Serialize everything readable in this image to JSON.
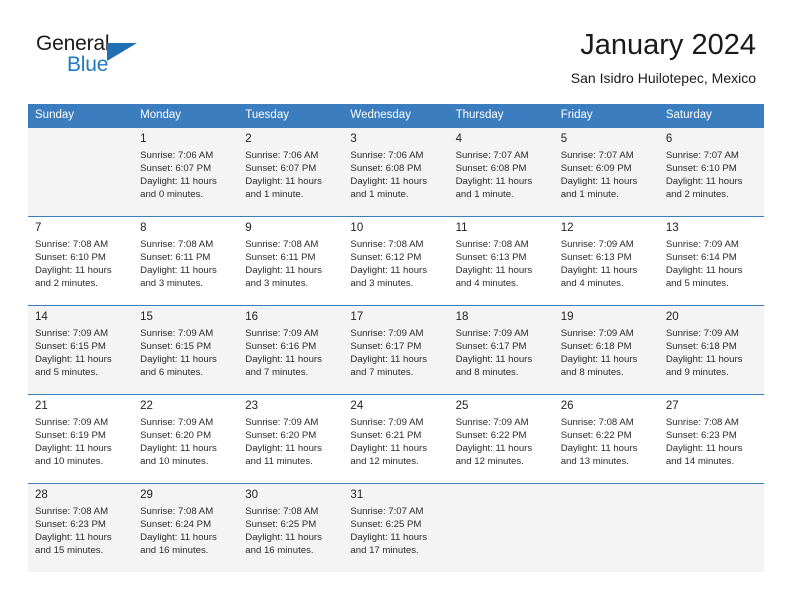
{
  "brand": {
    "word_one": "General",
    "word_two": "Blue",
    "accent_color": "#1f7ac0",
    "triangle_color": "#1f6fb5",
    "icon": "triangle-logo-icon"
  },
  "header": {
    "title": "January 2024",
    "location": "San Isidro Huilotepec, Mexico"
  },
  "calendar": {
    "header_bg": "#3b7dbf",
    "header_text_color": "#ffffff",
    "shaded_row_bg": "#f4f4f4",
    "weekday_headers": [
      "Sunday",
      "Monday",
      "Tuesday",
      "Wednesday",
      "Thursday",
      "Friday",
      "Saturday"
    ],
    "weeks": [
      {
        "shaded": true,
        "days": [
          {
            "empty": true
          },
          {
            "number": "1",
            "sunrise": "Sunrise: 7:06 AM",
            "sunset": "Sunset: 6:07 PM",
            "daylight_line1": "Daylight: 11 hours",
            "daylight_line2": "and 0 minutes."
          },
          {
            "number": "2",
            "sunrise": "Sunrise: 7:06 AM",
            "sunset": "Sunset: 6:07 PM",
            "daylight_line1": "Daylight: 11 hours",
            "daylight_line2": "and 1 minute."
          },
          {
            "number": "3",
            "sunrise": "Sunrise: 7:06 AM",
            "sunset": "Sunset: 6:08 PM",
            "daylight_line1": "Daylight: 11 hours",
            "daylight_line2": "and 1 minute."
          },
          {
            "number": "4",
            "sunrise": "Sunrise: 7:07 AM",
            "sunset": "Sunset: 6:08 PM",
            "daylight_line1": "Daylight: 11 hours",
            "daylight_line2": "and 1 minute."
          },
          {
            "number": "5",
            "sunrise": "Sunrise: 7:07 AM",
            "sunset": "Sunset: 6:09 PM",
            "daylight_line1": "Daylight: 11 hours",
            "daylight_line2": "and 1 minute."
          },
          {
            "number": "6",
            "sunrise": "Sunrise: 7:07 AM",
            "sunset": "Sunset: 6:10 PM",
            "daylight_line1": "Daylight: 11 hours",
            "daylight_line2": "and 2 minutes."
          }
        ]
      },
      {
        "shaded": false,
        "days": [
          {
            "number": "7",
            "sunrise": "Sunrise: 7:08 AM",
            "sunset": "Sunset: 6:10 PM",
            "daylight_line1": "Daylight: 11 hours",
            "daylight_line2": "and 2 minutes."
          },
          {
            "number": "8",
            "sunrise": "Sunrise: 7:08 AM",
            "sunset": "Sunset: 6:11 PM",
            "daylight_line1": "Daylight: 11 hours",
            "daylight_line2": "and 3 minutes."
          },
          {
            "number": "9",
            "sunrise": "Sunrise: 7:08 AM",
            "sunset": "Sunset: 6:11 PM",
            "daylight_line1": "Daylight: 11 hours",
            "daylight_line2": "and 3 minutes."
          },
          {
            "number": "10",
            "sunrise": "Sunrise: 7:08 AM",
            "sunset": "Sunset: 6:12 PM",
            "daylight_line1": "Daylight: 11 hours",
            "daylight_line2": "and 3 minutes."
          },
          {
            "number": "11",
            "sunrise": "Sunrise: 7:08 AM",
            "sunset": "Sunset: 6:13 PM",
            "daylight_line1": "Daylight: 11 hours",
            "daylight_line2": "and 4 minutes."
          },
          {
            "number": "12",
            "sunrise": "Sunrise: 7:09 AM",
            "sunset": "Sunset: 6:13 PM",
            "daylight_line1": "Daylight: 11 hours",
            "daylight_line2": "and 4 minutes."
          },
          {
            "number": "13",
            "sunrise": "Sunrise: 7:09 AM",
            "sunset": "Sunset: 6:14 PM",
            "daylight_line1": "Daylight: 11 hours",
            "daylight_line2": "and 5 minutes."
          }
        ]
      },
      {
        "shaded": true,
        "days": [
          {
            "number": "14",
            "sunrise": "Sunrise: 7:09 AM",
            "sunset": "Sunset: 6:15 PM",
            "daylight_line1": "Daylight: 11 hours",
            "daylight_line2": "and 5 minutes."
          },
          {
            "number": "15",
            "sunrise": "Sunrise: 7:09 AM",
            "sunset": "Sunset: 6:15 PM",
            "daylight_line1": "Daylight: 11 hours",
            "daylight_line2": "and 6 minutes."
          },
          {
            "number": "16",
            "sunrise": "Sunrise: 7:09 AM",
            "sunset": "Sunset: 6:16 PM",
            "daylight_line1": "Daylight: 11 hours",
            "daylight_line2": "and 7 minutes."
          },
          {
            "number": "17",
            "sunrise": "Sunrise: 7:09 AM",
            "sunset": "Sunset: 6:17 PM",
            "daylight_line1": "Daylight: 11 hours",
            "daylight_line2": "and 7 minutes."
          },
          {
            "number": "18",
            "sunrise": "Sunrise: 7:09 AM",
            "sunset": "Sunset: 6:17 PM",
            "daylight_line1": "Daylight: 11 hours",
            "daylight_line2": "and 8 minutes."
          },
          {
            "number": "19",
            "sunrise": "Sunrise: 7:09 AM",
            "sunset": "Sunset: 6:18 PM",
            "daylight_line1": "Daylight: 11 hours",
            "daylight_line2": "and 8 minutes."
          },
          {
            "number": "20",
            "sunrise": "Sunrise: 7:09 AM",
            "sunset": "Sunset: 6:18 PM",
            "daylight_line1": "Daylight: 11 hours",
            "daylight_line2": "and 9 minutes."
          }
        ]
      },
      {
        "shaded": false,
        "days": [
          {
            "number": "21",
            "sunrise": "Sunrise: 7:09 AM",
            "sunset": "Sunset: 6:19 PM",
            "daylight_line1": "Daylight: 11 hours",
            "daylight_line2": "and 10 minutes."
          },
          {
            "number": "22",
            "sunrise": "Sunrise: 7:09 AM",
            "sunset": "Sunset: 6:20 PM",
            "daylight_line1": "Daylight: 11 hours",
            "daylight_line2": "and 10 minutes."
          },
          {
            "number": "23",
            "sunrise": "Sunrise: 7:09 AM",
            "sunset": "Sunset: 6:20 PM",
            "daylight_line1": "Daylight: 11 hours",
            "daylight_line2": "and 11 minutes."
          },
          {
            "number": "24",
            "sunrise": "Sunrise: 7:09 AM",
            "sunset": "Sunset: 6:21 PM",
            "daylight_line1": "Daylight: 11 hours",
            "daylight_line2": "and 12 minutes."
          },
          {
            "number": "25",
            "sunrise": "Sunrise: 7:09 AM",
            "sunset": "Sunset: 6:22 PM",
            "daylight_line1": "Daylight: 11 hours",
            "daylight_line2": "and 12 minutes."
          },
          {
            "number": "26",
            "sunrise": "Sunrise: 7:08 AM",
            "sunset": "Sunset: 6:22 PM",
            "daylight_line1": "Daylight: 11 hours",
            "daylight_line2": "and 13 minutes."
          },
          {
            "number": "27",
            "sunrise": "Sunrise: 7:08 AM",
            "sunset": "Sunset: 6:23 PM",
            "daylight_line1": "Daylight: 11 hours",
            "daylight_line2": "and 14 minutes."
          }
        ]
      },
      {
        "shaded": true,
        "days": [
          {
            "number": "28",
            "sunrise": "Sunrise: 7:08 AM",
            "sunset": "Sunset: 6:23 PM",
            "daylight_line1": "Daylight: 11 hours",
            "daylight_line2": "and 15 minutes."
          },
          {
            "number": "29",
            "sunrise": "Sunrise: 7:08 AM",
            "sunset": "Sunset: 6:24 PM",
            "daylight_line1": "Daylight: 11 hours",
            "daylight_line2": "and 16 minutes."
          },
          {
            "number": "30",
            "sunrise": "Sunrise: 7:08 AM",
            "sunset": "Sunset: 6:25 PM",
            "daylight_line1": "Daylight: 11 hours",
            "daylight_line2": "and 16 minutes."
          },
          {
            "number": "31",
            "sunrise": "Sunrise: 7:07 AM",
            "sunset": "Sunset: 6:25 PM",
            "daylight_line1": "Daylight: 11 hours",
            "daylight_line2": "and 17 minutes."
          },
          {
            "empty": true
          },
          {
            "empty": true
          },
          {
            "empty": true
          }
        ]
      }
    ]
  }
}
